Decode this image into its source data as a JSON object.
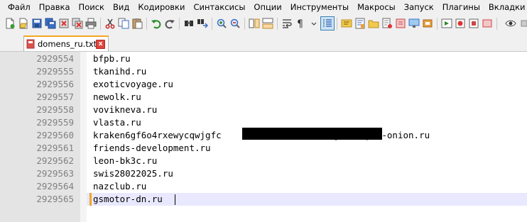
{
  "menu": [
    {
      "label": "Файл"
    },
    {
      "label": "Правка"
    },
    {
      "label": "Поиск"
    },
    {
      "label": "Вид"
    },
    {
      "label": "Кодировки"
    },
    {
      "label": "Синтаксисы"
    },
    {
      "label": "Опции"
    },
    {
      "label": "Инструменты"
    },
    {
      "label": "Макросы"
    },
    {
      "label": "Запуск"
    },
    {
      "label": "Плагины"
    },
    {
      "label": "Вкладки"
    }
  ],
  "toolbar": {
    "icons": [
      "new-file-icon",
      "open-file-icon",
      "save-icon",
      "save-all-icon",
      "close-icon",
      "close-all-icon",
      "print-icon",
      "cut-icon",
      "copy-icon",
      "paste-icon",
      "undo-icon",
      "redo-icon",
      "find-icon",
      "replace-icon",
      "zoom-in-icon",
      "zoom-out-icon",
      "sync-vertical-icon",
      "sync-horizontal-icon",
      "word-wrap-icon",
      "show-all-chars-icon",
      "indent-guide-icon",
      "function-list-icon",
      "document-map-icon",
      "folder-workspace-icon",
      "document-list-icon",
      "monitor-icon",
      "eye-icon"
    ]
  },
  "tab": {
    "label": "domens_ru.txt",
    "close_glyph": "x"
  },
  "editor": {
    "lines": [
      {
        "num": "2929554",
        "text": "bfpb.ru"
      },
      {
        "num": "2929555",
        "text": "tkanihd.ru"
      },
      {
        "num": "2929556",
        "text": "exoticvoyage.ru"
      },
      {
        "num": "2929557",
        "text": "newolk.ru"
      },
      {
        "num": "2929558",
        "text": "vovikneva.ru"
      },
      {
        "num": "2929559",
        "text": "vlasta.ru"
      },
      {
        "num": "2929560",
        "text": "kraken6gf6o4rxewycqwjgfc                   aig2vmxvyd--onion.ru"
      },
      {
        "num": "2929561",
        "text": "friends-development.ru"
      },
      {
        "num": "2929562",
        "text": "leon-bk3c.ru"
      },
      {
        "num": "2929563",
        "text": "swis28022025.ru"
      },
      {
        "num": "2929564",
        "text": "nazclub.ru"
      },
      {
        "num": "2929565",
        "text": "gsmotor-dn.ru"
      }
    ]
  },
  "colors": {
    "gutter": "#e4e4e4",
    "current_line": "#e8e8ff",
    "tab_accent": "#f5a623",
    "close_red": "#e0443e"
  }
}
